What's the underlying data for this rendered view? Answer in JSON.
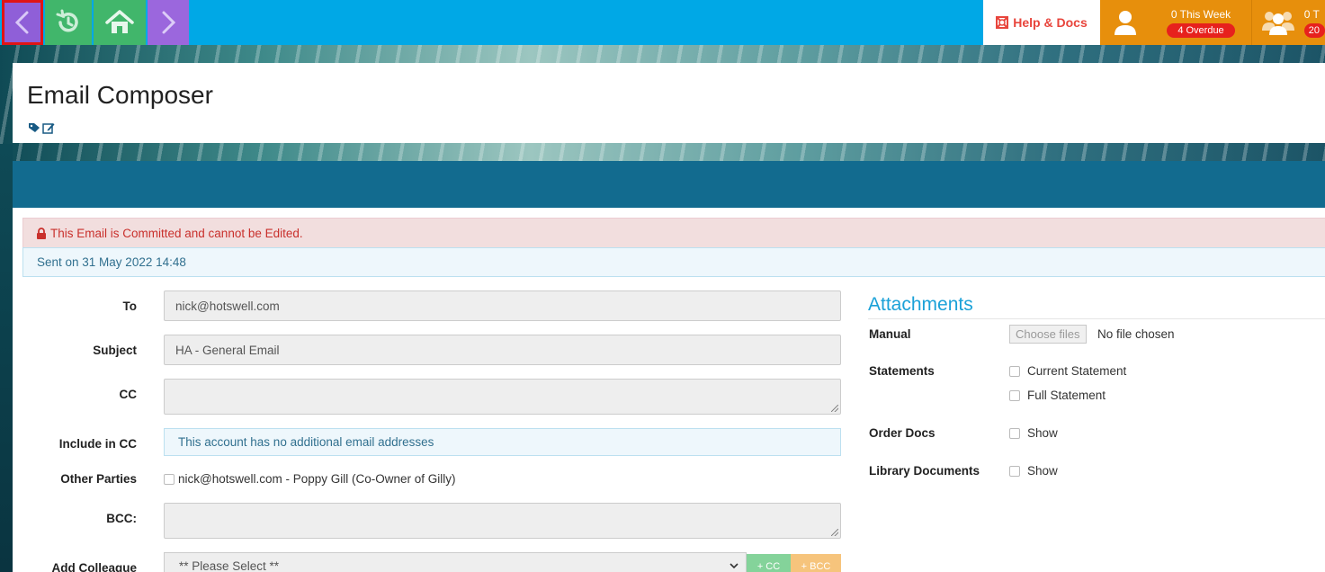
{
  "topbar": {
    "help_label": "Help & Docs",
    "user_stats": {
      "this_week": "0 This Week",
      "overdue": "4 Overdue"
    },
    "team_stats": {
      "count": "0 T",
      "badge": "20"
    }
  },
  "page": {
    "title": "Email Composer"
  },
  "alerts": {
    "committed": "This Email is Committed and cannot be Edited.",
    "sent": "Sent on 31 May 2022 14:48"
  },
  "form": {
    "to_label": "To",
    "to_value": "nick@hotswell.com",
    "subject_label": "Subject",
    "subject_value": "HA  - General Email",
    "cc_label": "CC",
    "cc_value": "",
    "include_cc_label": "Include in CC",
    "include_cc_note": "This account has no additional email addresses",
    "other_parties_label": "Other Parties",
    "other_parties_item": "nick@hotswell.com - Poppy Gill (Co-Owner of Gilly)",
    "bcc_label": "BCC:",
    "bcc_value": "",
    "add_colleague_label": "Add Colleague",
    "add_colleague_placeholder": "** Please Select **",
    "add_cc_button": "+ CC",
    "add_bcc_button": "+ BCC"
  },
  "attachments": {
    "heading": "Attachments",
    "manual_label": "Manual",
    "choose_files": "Choose files",
    "no_file": "No file chosen",
    "statements_label": "Statements",
    "current_statement": "Current Statement",
    "full_statement": "Full Statement",
    "order_docs_label": "Order Docs",
    "order_docs_option": "Show",
    "library_label": "Library Documents",
    "library_option": "Show"
  },
  "colors": {
    "topbar": "#00a8e6",
    "back": "#8f5fd8",
    "green": "#41b66b",
    "orange": "#e78f0c",
    "accent": "#1aa1d8"
  }
}
